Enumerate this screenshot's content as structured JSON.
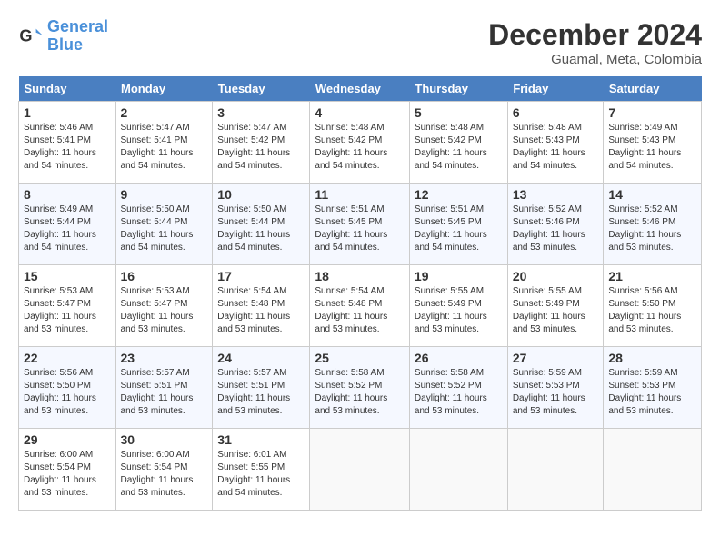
{
  "header": {
    "logo_line1": "General",
    "logo_line2": "Blue",
    "month_year": "December 2024",
    "location": "Guamal, Meta, Colombia"
  },
  "weekdays": [
    "Sunday",
    "Monday",
    "Tuesday",
    "Wednesday",
    "Thursday",
    "Friday",
    "Saturday"
  ],
  "weeks": [
    [
      {
        "day": "1",
        "sunrise": "5:46 AM",
        "sunset": "5:41 PM",
        "daylight": "11 hours and 54 minutes."
      },
      {
        "day": "2",
        "sunrise": "5:47 AM",
        "sunset": "5:41 PM",
        "daylight": "11 hours and 54 minutes."
      },
      {
        "day": "3",
        "sunrise": "5:47 AM",
        "sunset": "5:42 PM",
        "daylight": "11 hours and 54 minutes."
      },
      {
        "day": "4",
        "sunrise": "5:48 AM",
        "sunset": "5:42 PM",
        "daylight": "11 hours and 54 minutes."
      },
      {
        "day": "5",
        "sunrise": "5:48 AM",
        "sunset": "5:42 PM",
        "daylight": "11 hours and 54 minutes."
      },
      {
        "day": "6",
        "sunrise": "5:48 AM",
        "sunset": "5:43 PM",
        "daylight": "11 hours and 54 minutes."
      },
      {
        "day": "7",
        "sunrise": "5:49 AM",
        "sunset": "5:43 PM",
        "daylight": "11 hours and 54 minutes."
      }
    ],
    [
      {
        "day": "8",
        "sunrise": "5:49 AM",
        "sunset": "5:44 PM",
        "daylight": "11 hours and 54 minutes."
      },
      {
        "day": "9",
        "sunrise": "5:50 AM",
        "sunset": "5:44 PM",
        "daylight": "11 hours and 54 minutes."
      },
      {
        "day": "10",
        "sunrise": "5:50 AM",
        "sunset": "5:44 PM",
        "daylight": "11 hours and 54 minutes."
      },
      {
        "day": "11",
        "sunrise": "5:51 AM",
        "sunset": "5:45 PM",
        "daylight": "11 hours and 54 minutes."
      },
      {
        "day": "12",
        "sunrise": "5:51 AM",
        "sunset": "5:45 PM",
        "daylight": "11 hours and 54 minutes."
      },
      {
        "day": "13",
        "sunrise": "5:52 AM",
        "sunset": "5:46 PM",
        "daylight": "11 hours and 53 minutes."
      },
      {
        "day": "14",
        "sunrise": "5:52 AM",
        "sunset": "5:46 PM",
        "daylight": "11 hours and 53 minutes."
      }
    ],
    [
      {
        "day": "15",
        "sunrise": "5:53 AM",
        "sunset": "5:47 PM",
        "daylight": "11 hours and 53 minutes."
      },
      {
        "day": "16",
        "sunrise": "5:53 AM",
        "sunset": "5:47 PM",
        "daylight": "11 hours and 53 minutes."
      },
      {
        "day": "17",
        "sunrise": "5:54 AM",
        "sunset": "5:48 PM",
        "daylight": "11 hours and 53 minutes."
      },
      {
        "day": "18",
        "sunrise": "5:54 AM",
        "sunset": "5:48 PM",
        "daylight": "11 hours and 53 minutes."
      },
      {
        "day": "19",
        "sunrise": "5:55 AM",
        "sunset": "5:49 PM",
        "daylight": "11 hours and 53 minutes."
      },
      {
        "day": "20",
        "sunrise": "5:55 AM",
        "sunset": "5:49 PM",
        "daylight": "11 hours and 53 minutes."
      },
      {
        "day": "21",
        "sunrise": "5:56 AM",
        "sunset": "5:50 PM",
        "daylight": "11 hours and 53 minutes."
      }
    ],
    [
      {
        "day": "22",
        "sunrise": "5:56 AM",
        "sunset": "5:50 PM",
        "daylight": "11 hours and 53 minutes."
      },
      {
        "day": "23",
        "sunrise": "5:57 AM",
        "sunset": "5:51 PM",
        "daylight": "11 hours and 53 minutes."
      },
      {
        "day": "24",
        "sunrise": "5:57 AM",
        "sunset": "5:51 PM",
        "daylight": "11 hours and 53 minutes."
      },
      {
        "day": "25",
        "sunrise": "5:58 AM",
        "sunset": "5:52 PM",
        "daylight": "11 hours and 53 minutes."
      },
      {
        "day": "26",
        "sunrise": "5:58 AM",
        "sunset": "5:52 PM",
        "daylight": "11 hours and 53 minutes."
      },
      {
        "day": "27",
        "sunrise": "5:59 AM",
        "sunset": "5:53 PM",
        "daylight": "11 hours and 53 minutes."
      },
      {
        "day": "28",
        "sunrise": "5:59 AM",
        "sunset": "5:53 PM",
        "daylight": "11 hours and 53 minutes."
      }
    ],
    [
      {
        "day": "29",
        "sunrise": "6:00 AM",
        "sunset": "5:54 PM",
        "daylight": "11 hours and 53 minutes."
      },
      {
        "day": "30",
        "sunrise": "6:00 AM",
        "sunset": "5:54 PM",
        "daylight": "11 hours and 53 minutes."
      },
      {
        "day": "31",
        "sunrise": "6:01 AM",
        "sunset": "5:55 PM",
        "daylight": "11 hours and 54 minutes."
      },
      null,
      null,
      null,
      null
    ]
  ]
}
